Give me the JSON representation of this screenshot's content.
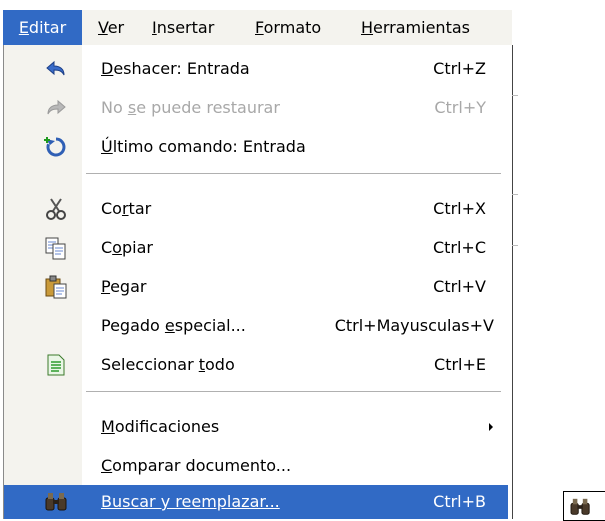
{
  "menubar": {
    "items": [
      {
        "label": "Editar",
        "mnemonic": "E",
        "rest": "ditar"
      },
      {
        "label": "Ver",
        "mnemonic": "V",
        "rest": "er"
      },
      {
        "label": "Insertar",
        "mnemonic": "I",
        "rest": "nsertar"
      },
      {
        "label": "Formato",
        "mnemonic": "F",
        "rest": "ormato"
      },
      {
        "label": "Herramientas",
        "mnemonic": "H",
        "rest": "erramientas"
      }
    ]
  },
  "menu": {
    "items": [
      {
        "pre": "",
        "mn": "D",
        "post": "eshacer: Entrada",
        "shortcut": "Ctrl+Z",
        "icon": "undo-icon"
      },
      {
        "pre": "No ",
        "mn": "s",
        "post": "e puede restaurar",
        "shortcut": "Ctrl+Y",
        "icon": "redo-icon",
        "disabled": true
      },
      {
        "pre": "",
        "mn": "Ú",
        "post": "ltimo comando: Entrada",
        "shortcut": "",
        "icon": "repeat-icon"
      },
      {
        "pre": "Co",
        "mn": "r",
        "post": "tar",
        "shortcut": "Ctrl+X",
        "icon": "scissors-icon"
      },
      {
        "pre": "C",
        "mn": "o",
        "post": "piar",
        "shortcut": "Ctrl+C",
        "icon": "copy-icon"
      },
      {
        "pre": "",
        "mn": "P",
        "post": "egar",
        "shortcut": "Ctrl+V",
        "icon": "paste-icon"
      },
      {
        "pre": "Pegado ",
        "mn": "e",
        "post": "special...",
        "shortcut": "Ctrl+Mayusculas+V",
        "icon": ""
      },
      {
        "pre": "Seleccionar ",
        "mn": "t",
        "post": "odo",
        "shortcut": "Ctrl+E",
        "icon": "select-all-icon"
      },
      {
        "pre": "",
        "mn": "M",
        "post": "odificaciones",
        "shortcut": "",
        "icon": "",
        "submenu": true
      },
      {
        "pre": "",
        "mn": "C",
        "post": "omparar documento...",
        "shortcut": "",
        "icon": ""
      },
      {
        "pre": "Buscar y reemplazar...",
        "mn": "",
        "post": "",
        "shortcut": "Ctrl+B",
        "icon": "binoculars-icon",
        "highlighted": true
      }
    ]
  },
  "colors": {
    "highlight": "#316ac5",
    "gutter": "#f4f3ee",
    "disabled_text": "#a8a8a8"
  }
}
